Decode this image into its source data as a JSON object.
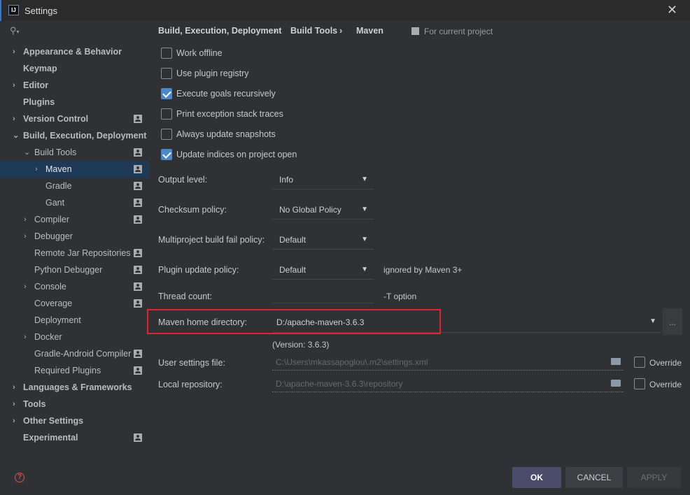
{
  "window": {
    "title": "Settings",
    "logo": "IJ",
    "close_icon": "close-icon"
  },
  "sidebar": {
    "items": [
      {
        "label": "Appearance & Behavior",
        "level": 0,
        "chev": "›",
        "bold": true,
        "person": false
      },
      {
        "label": "Keymap",
        "level": 0,
        "chev": "",
        "bold": true,
        "person": false
      },
      {
        "label": "Editor",
        "level": 0,
        "chev": "›",
        "bold": true,
        "person": false
      },
      {
        "label": "Plugins",
        "level": 0,
        "chev": "",
        "bold": true,
        "person": false
      },
      {
        "label": "Version Control",
        "level": 0,
        "chev": "›",
        "bold": true,
        "person": true
      },
      {
        "label": "Build, Execution, Deployment",
        "level": 0,
        "chev": "⌄",
        "bold": true,
        "person": false
      },
      {
        "label": "Build Tools",
        "level": 1,
        "chev": "⌄",
        "bold": false,
        "person": true
      },
      {
        "label": "Maven",
        "level": 2,
        "chev": "›",
        "bold": false,
        "person": true,
        "selected": true
      },
      {
        "label": "Gradle",
        "level": 2,
        "chev": "",
        "bold": false,
        "person": true
      },
      {
        "label": "Gant",
        "level": 2,
        "chev": "",
        "bold": false,
        "person": true
      },
      {
        "label": "Compiler",
        "level": 1,
        "chev": "›",
        "bold": false,
        "person": true
      },
      {
        "label": "Debugger",
        "level": 1,
        "chev": "›",
        "bold": false,
        "person": false
      },
      {
        "label": "Remote Jar Repositories",
        "level": 1,
        "chev": "",
        "bold": false,
        "person": true
      },
      {
        "label": "Python Debugger",
        "level": 1,
        "chev": "",
        "bold": false,
        "person": true
      },
      {
        "label": "Console",
        "level": 1,
        "chev": "›",
        "bold": false,
        "person": true
      },
      {
        "label": "Coverage",
        "level": 1,
        "chev": "",
        "bold": false,
        "person": true
      },
      {
        "label": "Deployment",
        "level": 1,
        "chev": "",
        "bold": false,
        "person": false
      },
      {
        "label": "Docker",
        "level": 1,
        "chev": "›",
        "bold": false,
        "person": false
      },
      {
        "label": "Gradle-Android Compiler",
        "level": 1,
        "chev": "",
        "bold": false,
        "person": true
      },
      {
        "label": "Required Plugins",
        "level": 1,
        "chev": "",
        "bold": false,
        "person": true
      },
      {
        "label": "Languages & Frameworks",
        "level": 0,
        "chev": "›",
        "bold": true,
        "person": false
      },
      {
        "label": "Tools",
        "level": 0,
        "chev": "›",
        "bold": true,
        "person": false
      },
      {
        "label": "Other Settings",
        "level": 0,
        "chev": "›",
        "bold": true,
        "person": false
      },
      {
        "label": "Experimental",
        "level": 0,
        "chev": "",
        "bold": true,
        "person": true
      }
    ]
  },
  "breadcrumb": [
    "Build, Execution, Deployment",
    "Build Tools",
    "Maven"
  ],
  "breadcrumb_sep": "›",
  "scope": "For current project",
  "checkboxes": [
    {
      "label": "Work offline",
      "checked": false
    },
    {
      "label": "Use plugin registry",
      "checked": false
    },
    {
      "label": "Execute goals recursively",
      "checked": true
    },
    {
      "label": "Print exception stack traces",
      "checked": false
    },
    {
      "label": "Always update snapshots",
      "checked": false
    },
    {
      "label": "Update indices on project open",
      "checked": true
    }
  ],
  "selects": [
    {
      "label": "Output level:",
      "value": "Info",
      "hint": ""
    },
    {
      "label": "Checksum policy:",
      "value": "No Global Policy",
      "hint": ""
    },
    {
      "label": "Multiproject build fail policy:",
      "value": "Default",
      "hint": ""
    },
    {
      "label": "Plugin update policy:",
      "value": "Default",
      "hint": "ignored by Maven 3+"
    }
  ],
  "thread": {
    "label": "Thread count:",
    "value": "",
    "hint": "-T option"
  },
  "maven_home": {
    "label": "Maven home directory:",
    "value": "D:/apache-maven-3.6.3",
    "browse": "...",
    "version": "(Version: 3.6.3)",
    "highlight": "#e0242b"
  },
  "user_settings": {
    "label": "User settings file:",
    "value": "C:\\Users\\mkassapoglou\\.m2\\settings.xml",
    "override": "Override"
  },
  "local_repo": {
    "label": "Local repository:",
    "value": "D:\\apache-maven-3.6.3\\repository",
    "override": "Override"
  },
  "buttons": {
    "ok": "OK",
    "cancel": "CANCEL",
    "apply": "APPLY"
  },
  "help_icon": "?"
}
